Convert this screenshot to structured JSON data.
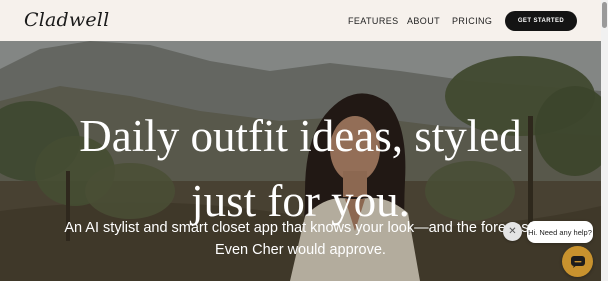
{
  "header": {
    "logo": "Cladwell",
    "nav": [
      {
        "label": "FEATURES"
      },
      {
        "label": "ABOUT"
      },
      {
        "label": "PRICING"
      }
    ],
    "cta_label": "GET STARTED"
  },
  "hero": {
    "title_line1": "Daily outfit ideas, styled",
    "title_line2": "just for you.",
    "subtitle_line1": "An AI stylist and smart closet app that knows your look—and the forecast.",
    "subtitle_line2": "Even Cher would approve."
  },
  "chat": {
    "close_glyph": "✕",
    "greeting": "Hi. Need any help?",
    "launcher_icon": "chat-icon"
  },
  "colors": {
    "header_bg": "#f6f1ec",
    "cta_bg": "#141414",
    "launcher_bg": "#c8922e"
  }
}
